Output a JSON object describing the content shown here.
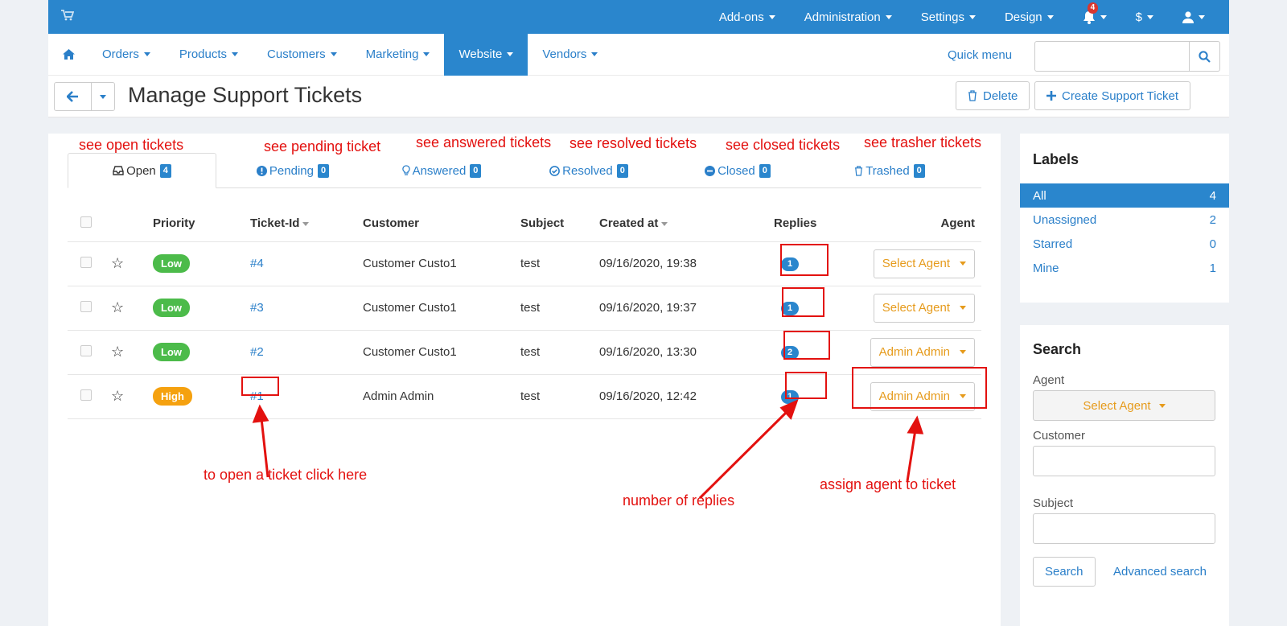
{
  "topbar": {
    "items": [
      "Add-ons",
      "Administration",
      "Settings",
      "Design"
    ],
    "notifications": "4",
    "currency": "$"
  },
  "mainnav": {
    "items": [
      "Orders",
      "Products",
      "Customers",
      "Marketing",
      "Website",
      "Vendors"
    ],
    "active": "Website",
    "quick_menu": "Quick menu"
  },
  "titlebar": {
    "title": "Manage Support Tickets",
    "delete": "Delete",
    "create": "Create Support Ticket"
  },
  "tabs": [
    {
      "label": "Open",
      "count": "4"
    },
    {
      "label": "Pending",
      "count": "0"
    },
    {
      "label": "Answered",
      "count": "0"
    },
    {
      "label": "Resolved",
      "count": "0"
    },
    {
      "label": "Closed",
      "count": "0"
    },
    {
      "label": "Trashed",
      "count": "0"
    }
  ],
  "annotations": {
    "open": "see open tickets",
    "pending": "see pending ticket",
    "answered": "see answered tickets",
    "resolved": "see resolved tickets",
    "closed": "see closed tickets",
    "trashed": "see trasher tickets",
    "open_ticket": "to open a ticket click here",
    "replies": "number of replies",
    "assign": "assign agent to ticket"
  },
  "table": {
    "headers": [
      "Priority",
      "Ticket-Id",
      "Customer",
      "Subject",
      "Created at",
      "Replies",
      "Agent"
    ],
    "rows": [
      {
        "priority": "Low",
        "id": "#4",
        "customer": "Customer Custo1",
        "subject": "test",
        "created": "09/16/2020, 19:38",
        "replies": "1",
        "agent": "Select Agent"
      },
      {
        "priority": "Low",
        "id": "#3",
        "customer": "Customer Custo1",
        "subject": "test",
        "created": "09/16/2020, 19:37",
        "replies": "1",
        "agent": "Select Agent"
      },
      {
        "priority": "Low",
        "id": "#2",
        "customer": "Customer Custo1",
        "subject": "test",
        "created": "09/16/2020, 13:30",
        "replies": "2",
        "agent": "Admin Admin"
      },
      {
        "priority": "High",
        "id": "#1",
        "customer": "Admin Admin",
        "subject": "test",
        "created": "09/16/2020, 12:42",
        "replies": "1",
        "agent": "Admin Admin"
      }
    ]
  },
  "labels": {
    "title": "Labels",
    "items": [
      {
        "name": "All",
        "count": "4"
      },
      {
        "name": "Unassigned",
        "count": "2"
      },
      {
        "name": "Starred",
        "count": "0"
      },
      {
        "name": "Mine",
        "count": "1"
      }
    ]
  },
  "search": {
    "title": "Search",
    "agent_label": "Agent",
    "agent_value": "Select Agent",
    "customer_label": "Customer",
    "subject_label": "Subject",
    "search_button": "Search",
    "advanced": "Advanced search"
  },
  "colors": {
    "primary": "#2a86cd",
    "low": "#4cbb4a",
    "high": "#f5a10f",
    "annotation": "#e3110f"
  }
}
